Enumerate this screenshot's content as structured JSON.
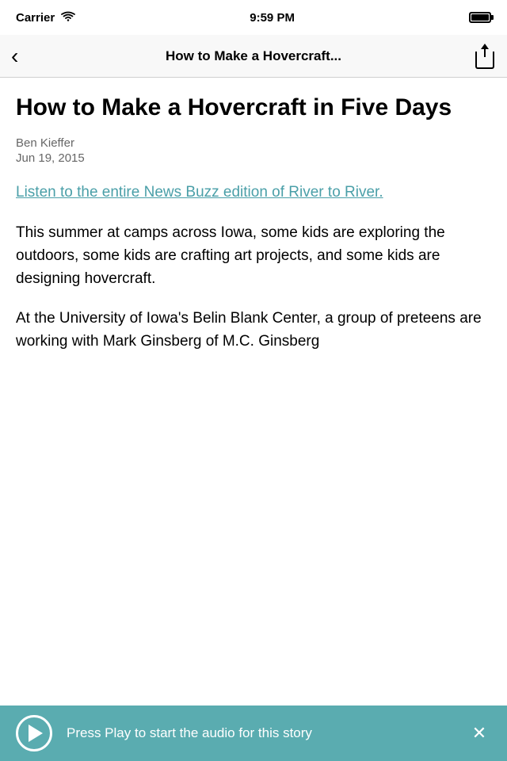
{
  "statusBar": {
    "carrier": "Carrier",
    "time": "9:59 PM"
  },
  "navBar": {
    "backLabel": "‹",
    "title": "How to Make a Hovercraft...",
    "shareLabel": "share"
  },
  "article": {
    "title": "How to Make a Hovercraft in Five Days",
    "author": "Ben Kieffer",
    "date": "Jun 19, 2015",
    "linkText": "Listen to the entire News Buzz edition of River to River.",
    "body1": "This summer at camps across Iowa, some kids are exploring the outdoors, some kids are crafting art projects, and some kids are designing hovercraft.",
    "body2": "At the University of Iowa's Belin Blank Center, a group of preteens are working with Mark Ginsberg of M.C. Ginsberg"
  },
  "audioBar": {
    "playLabel": "play",
    "text": "Press Play to start the audio for this story",
    "closeLabel": "close"
  }
}
